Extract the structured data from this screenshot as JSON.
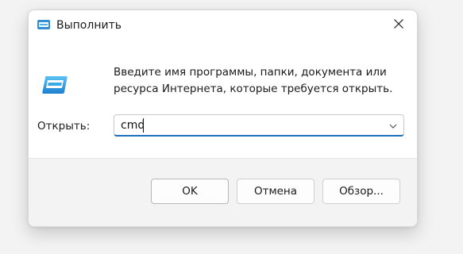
{
  "window": {
    "title": "Выполнить",
    "icon": "run-icon",
    "close_icon": "close-icon"
  },
  "main": {
    "description": "Введите имя программы, папки, документа или ресурса Интернета, которые требуется открыть.",
    "icon": "run-program-icon",
    "open_label": "Открыть:",
    "open_value": "cmd",
    "dropdown_icon": "chevron-down-icon"
  },
  "footer": {
    "ok_label": "OK",
    "cancel_label": "Отмена",
    "browse_label": "Обзор..."
  },
  "colors": {
    "accent": "#1f6fbf",
    "icon_blue": "#2e8fd6"
  }
}
